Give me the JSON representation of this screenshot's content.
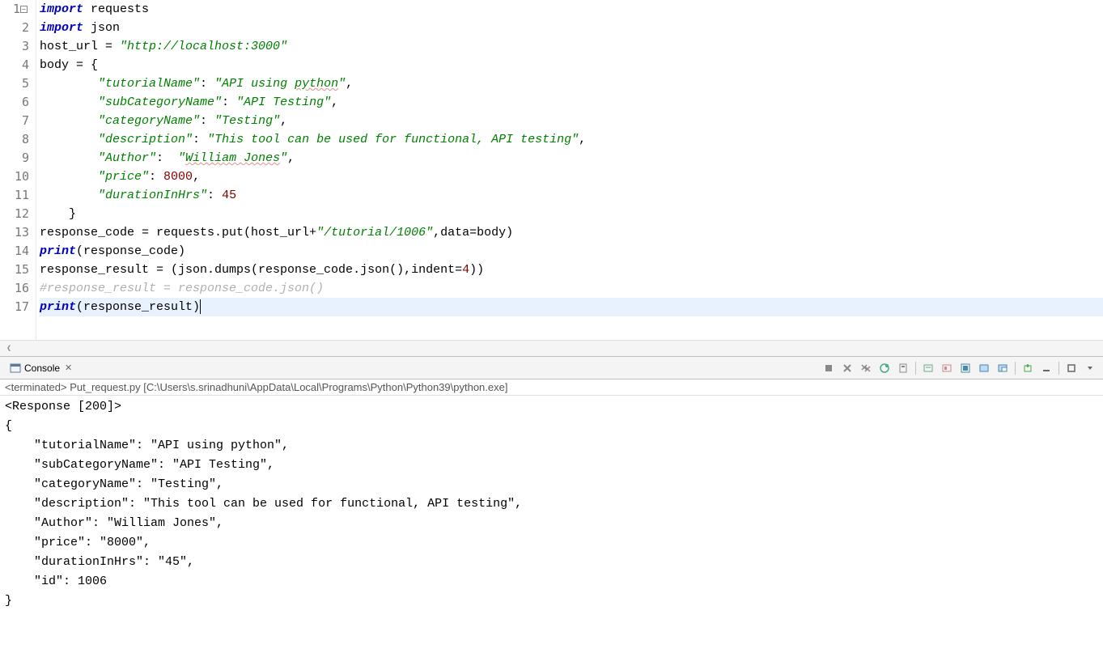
{
  "editor": {
    "lines": [
      {
        "num": 1,
        "fold": true,
        "tokens": [
          {
            "t": "kw",
            "v": "import"
          },
          {
            "t": "plain",
            "v": " requests"
          }
        ]
      },
      {
        "num": 2,
        "tokens": [
          {
            "t": "kw",
            "v": "import"
          },
          {
            "t": "plain",
            "v": " json"
          }
        ]
      },
      {
        "num": 3,
        "tokens": [
          {
            "t": "plain",
            "v": "host_url = "
          },
          {
            "t": "str",
            "v": "\"http://localhost:3000\""
          }
        ]
      },
      {
        "num": 4,
        "tokens": [
          {
            "t": "plain",
            "v": "body = {"
          }
        ]
      },
      {
        "num": 5,
        "tokens": [
          {
            "t": "plain",
            "v": "        "
          },
          {
            "t": "str",
            "v": "\"tutorialName\""
          },
          {
            "t": "plain",
            "v": ": "
          },
          {
            "t": "str",
            "v": "\"API using "
          },
          {
            "t": "str",
            "v": "python",
            "spell": true
          },
          {
            "t": "str",
            "v": "\""
          },
          {
            "t": "plain",
            "v": ","
          }
        ]
      },
      {
        "num": 6,
        "tokens": [
          {
            "t": "plain",
            "v": "        "
          },
          {
            "t": "str",
            "v": "\"subCategoryName\""
          },
          {
            "t": "plain",
            "v": ": "
          },
          {
            "t": "str",
            "v": "\"API Testing\""
          },
          {
            "t": "plain",
            "v": ","
          }
        ]
      },
      {
        "num": 7,
        "tokens": [
          {
            "t": "plain",
            "v": "        "
          },
          {
            "t": "str",
            "v": "\"categoryName\""
          },
          {
            "t": "plain",
            "v": ": "
          },
          {
            "t": "str",
            "v": "\"Testing\""
          },
          {
            "t": "plain",
            "v": ","
          }
        ]
      },
      {
        "num": 8,
        "tokens": [
          {
            "t": "plain",
            "v": "        "
          },
          {
            "t": "str",
            "v": "\"description\""
          },
          {
            "t": "plain",
            "v": ": "
          },
          {
            "t": "str",
            "v": "\"This tool can be used for functional, API testing\""
          },
          {
            "t": "plain",
            "v": ","
          }
        ]
      },
      {
        "num": 9,
        "tokens": [
          {
            "t": "plain",
            "v": "        "
          },
          {
            "t": "str",
            "v": "\"Author\""
          },
          {
            "t": "plain",
            "v": ":  "
          },
          {
            "t": "str",
            "v": "\""
          },
          {
            "t": "str",
            "v": "William Jones",
            "spell": true
          },
          {
            "t": "str",
            "v": "\""
          },
          {
            "t": "plain",
            "v": ","
          }
        ]
      },
      {
        "num": 10,
        "tokens": [
          {
            "t": "plain",
            "v": "        "
          },
          {
            "t": "str",
            "v": "\"price\""
          },
          {
            "t": "plain",
            "v": ": "
          },
          {
            "t": "num",
            "v": "8000"
          },
          {
            "t": "plain",
            "v": ","
          }
        ]
      },
      {
        "num": 11,
        "tokens": [
          {
            "t": "plain",
            "v": "        "
          },
          {
            "t": "str",
            "v": "\"durationInHrs\""
          },
          {
            "t": "plain",
            "v": ": "
          },
          {
            "t": "num",
            "v": "45"
          }
        ]
      },
      {
        "num": 12,
        "tokens": [
          {
            "t": "plain",
            "v": "    }"
          }
        ]
      },
      {
        "num": 13,
        "tokens": [
          {
            "t": "plain",
            "v": "response_code = requests.put(host_url+"
          },
          {
            "t": "str",
            "v": "\"/tutorial/1006\""
          },
          {
            "t": "plain",
            "v": ",data=body)"
          }
        ]
      },
      {
        "num": 14,
        "tokens": [
          {
            "t": "kw",
            "v": "print"
          },
          {
            "t": "plain",
            "v": "(response_code)"
          }
        ]
      },
      {
        "num": 15,
        "tokens": [
          {
            "t": "plain",
            "v": "response_result = (json.dumps(response_code.json(),indent="
          },
          {
            "t": "num",
            "v": "4"
          },
          {
            "t": "plain",
            "v": "))"
          }
        ]
      },
      {
        "num": 16,
        "tokens": [
          {
            "t": "comment",
            "v": "#response_result = response_code.json()"
          }
        ]
      },
      {
        "num": 17,
        "current": true,
        "tokens": [
          {
            "t": "kw",
            "v": "print"
          },
          {
            "t": "plain",
            "v": "(response_result)"
          }
        ],
        "cursor": true
      }
    ]
  },
  "console": {
    "tab_label": "Console",
    "info": "<terminated> Put_request.py [C:\\Users\\s.srinadhuni\\AppData\\Local\\Programs\\Python\\Python39\\python.exe]",
    "output": "<Response [200]>\n{\n    \"tutorialName\": \"API using python\",\n    \"subCategoryName\": \"API Testing\",\n    \"categoryName\": \"Testing\",\n    \"description\": \"This tool can be used for functional, API testing\",\n    \"Author\": \"William Jones\",\n    \"price\": \"8000\",\n    \"durationInHrs\": \"45\",\n    \"id\": 1006\n}"
  },
  "toolbar": {
    "icons": [
      "terminate-icon",
      "remove-launch-icon",
      "remove-all-icon",
      "clear-console-icon",
      "scroll-lock-icon",
      "sep",
      "show-console-icon",
      "pin-console-icon",
      "display-selected-icon",
      "open-console-icon",
      "open-console-2-icon",
      "sep",
      "new-console-icon",
      "minimize-icon",
      "sep",
      "maximize-icon",
      "menu-icon"
    ]
  }
}
